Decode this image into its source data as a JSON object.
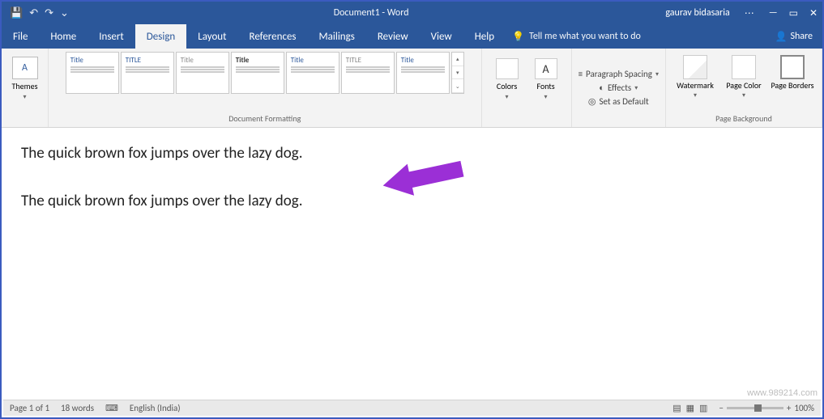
{
  "titlebar": {
    "doc_title": "Document1 - Word",
    "user": "gaurav bidasaria"
  },
  "qat": {
    "save": "💾",
    "undo": "↶",
    "redo": "↷",
    "custom": "⌄"
  },
  "win": {
    "opts": "⋯",
    "min": "—",
    "max": "▭",
    "close": "✕"
  },
  "tabs": {
    "file": "File",
    "home": "Home",
    "insert": "Insert",
    "design": "Design",
    "layout": "Layout",
    "references": "References",
    "mailings": "Mailings",
    "review": "Review",
    "view": "View",
    "help": "Help",
    "tellme_icon": "💡",
    "tellme": "Tell me what you want to do",
    "share_icon": "👤",
    "share": "Share"
  },
  "ribbon": {
    "themes": "Themes",
    "group_docfmt": "Document Formatting",
    "style_heading1": "Title",
    "style_heading2": "TITLE",
    "style_heading3": "Title",
    "style_heading4": "Title",
    "style_heading5": "TITLE",
    "colors": "Colors",
    "fonts": "Fonts",
    "para_spacing": "Paragraph Spacing",
    "effects": "Effects",
    "set_default": "Set as Default",
    "watermark": "Watermark",
    "page_color": "Page Color",
    "page_borders": "Page Borders",
    "group_pagebg": "Page Background"
  },
  "doc": {
    "line1": "The quick brown fox jumps over the lazy dog.",
    "line2": "The quick brown fox jumps over the lazy dog."
  },
  "status": {
    "page": "Page 1 of 1",
    "words": "18 words",
    "lang_icon": "⌨",
    "lang": "English (India)",
    "zoom_minus": "−",
    "zoom_plus": "+",
    "zoom_pct": "100%"
  },
  "watermark": "www.989214.com"
}
